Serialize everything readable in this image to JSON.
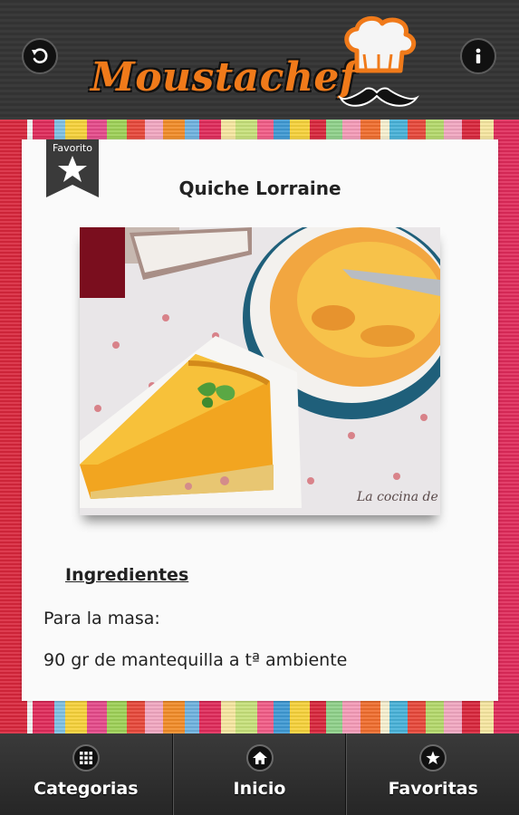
{
  "header": {
    "app_name": "Moustachef",
    "back_icon": "back-arrow-icon",
    "info_icon": "info-icon"
  },
  "recipe": {
    "favorite_badge": "Favorito",
    "title": "Quiche Lorraine",
    "photo_watermark": "La cocina de",
    "ingredients_heading": "Ingredientes",
    "lines": [
      "Para la masa:",
      "90 gr de mantequilla a tª ambiente"
    ]
  },
  "nav": {
    "items": [
      {
        "label": "Categorias",
        "icon": "grid-icon"
      },
      {
        "label": "Inicio",
        "icon": "home-icon"
      },
      {
        "label": "Favoritas",
        "icon": "star-icon"
      }
    ]
  },
  "colors": {
    "logo_orange": "#f07a1a",
    "header_bg": "#363636",
    "card_bg": "#fafafa"
  }
}
